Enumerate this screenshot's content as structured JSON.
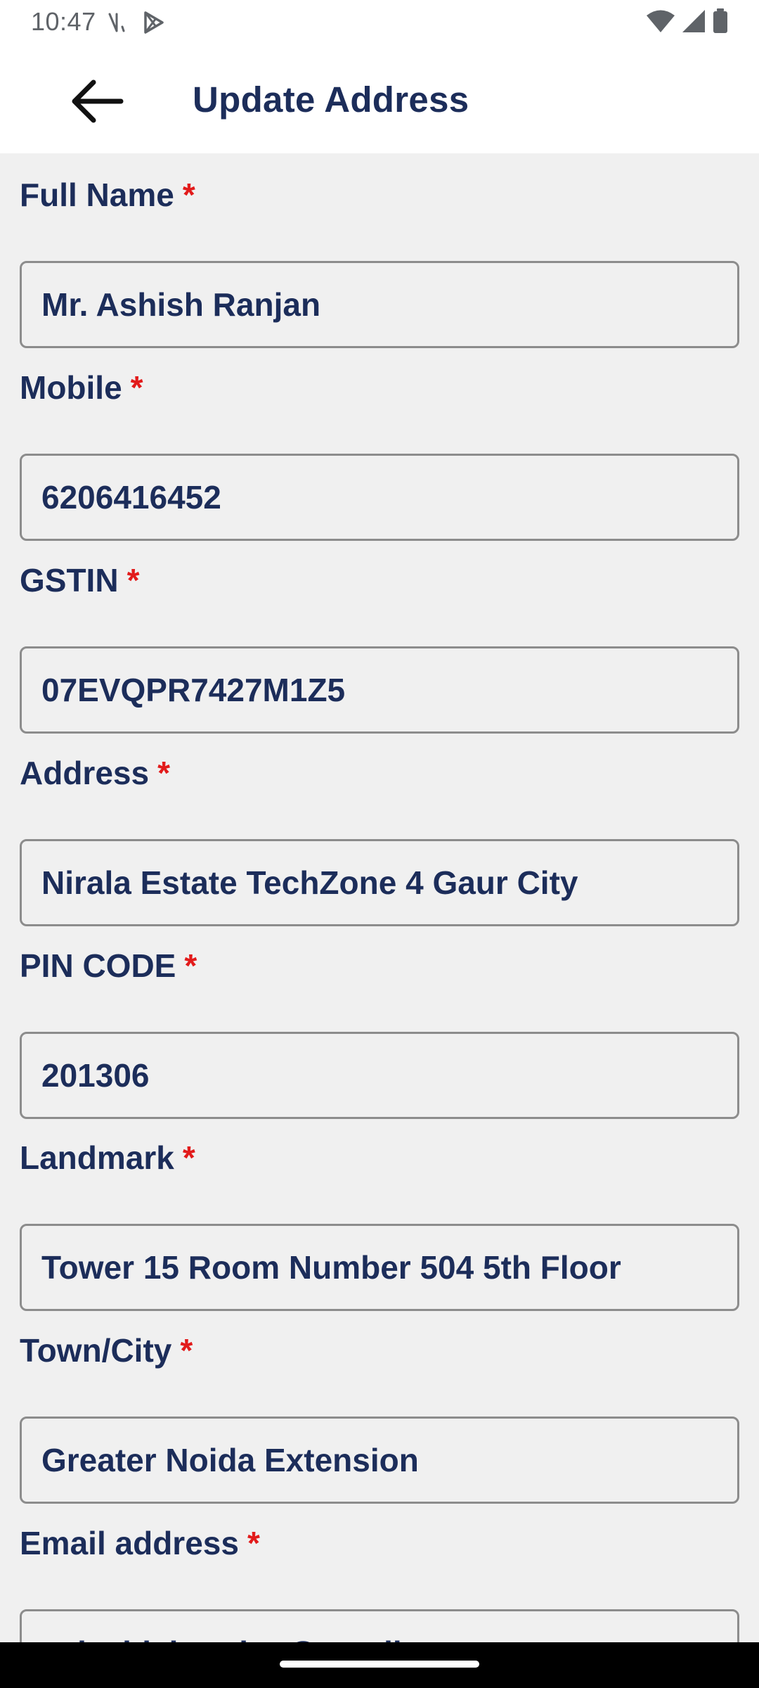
{
  "status_bar": {
    "time": "10:47",
    "icons": [
      "antenna-icon",
      "play-store-icon",
      "wifi-icon",
      "signal-icon",
      "battery-icon"
    ]
  },
  "app_bar": {
    "title": "Update Address",
    "back_icon": "arrow-left-icon"
  },
  "form": {
    "required_marker": "*",
    "fields": [
      {
        "label": "Full Name",
        "value": "Mr. Ashish Ranjan"
      },
      {
        "label": "Mobile",
        "value": "6206416452"
      },
      {
        "label": "GSTIN",
        "value": "07EVQPR7427M1Z5"
      },
      {
        "label": "Address",
        "value": "Nirala Estate TechZone 4 Gaur City"
      },
      {
        "label": "PIN CODE",
        "value": "201306"
      },
      {
        "label": "Landmark",
        "value": "Tower 15 Room Number 504 5th Floor"
      },
      {
        "label": "Town/City",
        "value": "Greater Noida Extension"
      },
      {
        "label": "Email address",
        "value": "aviashishranjan@gmail.com"
      }
    ]
  },
  "colors": {
    "label": "#1c2d5a",
    "required": "#e21b1b",
    "background": "#f0f0f0",
    "border": "#8c8c8c"
  }
}
